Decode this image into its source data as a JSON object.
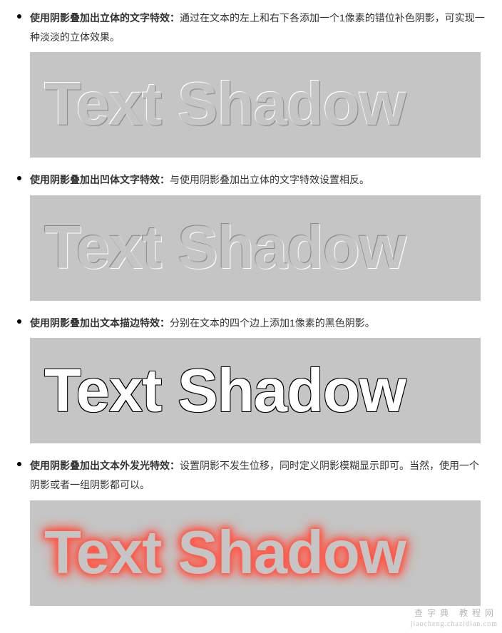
{
  "sections": [
    {
      "title": "使用阴影叠加出立体的文字特效：",
      "desc": "通过在文本的左上和右下各添加一个1像素的错位补色阴影，可实现一种淡淡的立体效果。",
      "demo_text": "Text Shadow",
      "fx": "fx-raised"
    },
    {
      "title": "使用阴影叠加出凹体文字特效：",
      "desc": "与使用阴影叠加出立体的文字特效设置相反。",
      "demo_text": "Text Shadow",
      "fx": "fx-inset"
    },
    {
      "title": "使用阴影叠加出文本描边特效：",
      "desc": "分别在文本的四个边上添加1像素的黑色阴影。",
      "demo_text": "Text Shadow",
      "fx": "fx-stroke"
    },
    {
      "title": "使用阴影叠加出文本外发光特效：",
      "desc": "设置阴影不发生位移，同时定义阴影模糊显示即可。当然，使用一个阴影或者一组阴影都可以。",
      "demo_text": "Text Shadow",
      "fx": "fx-glow"
    }
  ],
  "watermark": {
    "line1": "查字典 教程网",
    "line2": "jiaocheng.chazidian.com"
  }
}
